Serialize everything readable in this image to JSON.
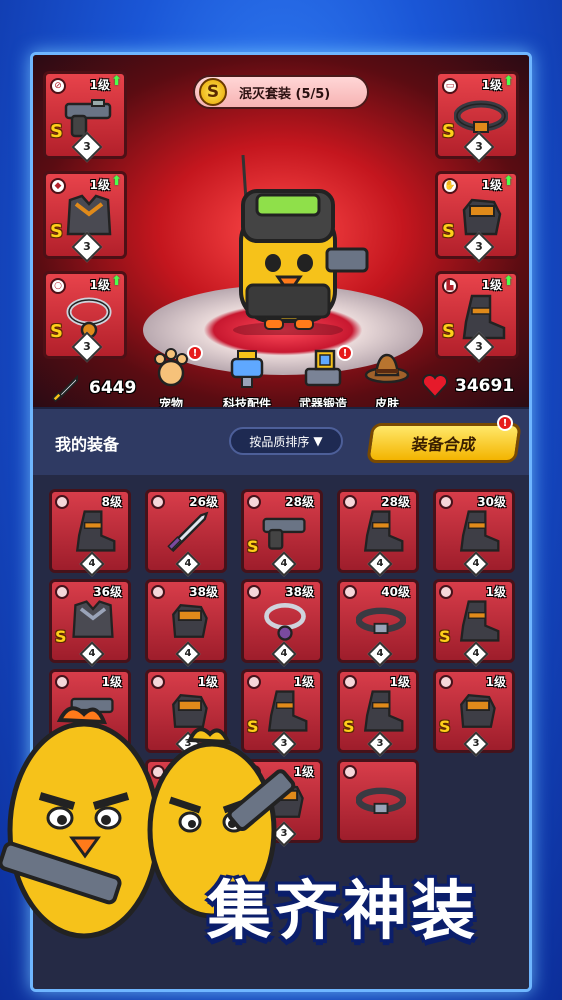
{
  "set_banner": {
    "grade": "S",
    "name": "泯灭套装 (5/5)"
  },
  "equipped": [
    {
      "slot": "weapon",
      "level": "1级",
      "grade": "S",
      "stars": "3",
      "icon": "pistol-icon"
    },
    {
      "slot": "armor",
      "level": "1级",
      "grade": "S",
      "stars": "3",
      "icon": "armor-icon"
    },
    {
      "slot": "necklace",
      "level": "1级",
      "grade": "S",
      "stars": "3",
      "icon": "necklace-icon"
    },
    {
      "slot": "belt",
      "level": "1级",
      "grade": "S",
      "stars": "3",
      "icon": "belt-icon"
    },
    {
      "slot": "gloves",
      "level": "1级",
      "grade": "S",
      "stars": "3",
      "icon": "glove-icon"
    },
    {
      "slot": "boots",
      "level": "1级",
      "grade": "S",
      "stars": "3",
      "icon": "boot-icon"
    }
  ],
  "features": [
    {
      "label": "宠物",
      "icon": "paw-icon",
      "badge": "!"
    },
    {
      "label": "科技配件",
      "icon": "tech-icon",
      "badge": ""
    },
    {
      "label": "武器锻造",
      "icon": "forge-icon",
      "badge": "!"
    },
    {
      "label": "皮肤",
      "icon": "hat-icon",
      "badge": ""
    }
  ],
  "stats": {
    "attack": "6449",
    "health": "34691"
  },
  "equip_bar": {
    "title": "我的装备",
    "sort_label": "按品质排序",
    "merge_label": "装备合成",
    "merge_badge": "!"
  },
  "inventory": [
    {
      "level": "8级",
      "grade": "",
      "stars": "4",
      "icon": "boot-icon"
    },
    {
      "level": "26级",
      "grade": "",
      "stars": "4",
      "icon": "sword-icon"
    },
    {
      "level": "28级",
      "grade": "S",
      "stars": "4",
      "icon": "pistol-icon"
    },
    {
      "level": "28级",
      "grade": "",
      "stars": "4",
      "icon": "boot-icon"
    },
    {
      "level": "30级",
      "grade": "",
      "stars": "4",
      "icon": "boot-icon"
    },
    {
      "level": "36级",
      "grade": "S",
      "stars": "4",
      "icon": "armor-icon"
    },
    {
      "level": "38级",
      "grade": "",
      "stars": "4",
      "icon": "glove-icon"
    },
    {
      "level": "38级",
      "grade": "",
      "stars": "4",
      "icon": "necklace-icon"
    },
    {
      "level": "40级",
      "grade": "",
      "stars": "4",
      "icon": "belt-icon"
    },
    {
      "level": "1级",
      "grade": "S",
      "stars": "4",
      "icon": "boot-icon"
    },
    {
      "level": "1级",
      "grade": "",
      "stars": "",
      "icon": "pistol-icon"
    },
    {
      "level": "1级",
      "grade": "",
      "stars": "3",
      "icon": "glove-icon"
    },
    {
      "level": "1级",
      "grade": "S",
      "stars": "3",
      "icon": "boot-icon"
    },
    {
      "level": "1级",
      "grade": "S",
      "stars": "3",
      "icon": "boot-icon"
    },
    {
      "level": "1级",
      "grade": "S",
      "stars": "3",
      "icon": "glove-icon"
    },
    {
      "level": "1级",
      "grade": "",
      "stars": "",
      "icon": "boot-icon"
    },
    {
      "level": "1级",
      "grade": "",
      "stars": "",
      "icon": "belt-icon"
    },
    {
      "level": "1级",
      "grade": "S",
      "stars": "3",
      "icon": "glove-icon"
    },
    {
      "level": "",
      "grade": "",
      "stars": "",
      "icon": "belt-icon"
    }
  ],
  "promo": {
    "text": "集齐神装"
  },
  "colors": {
    "slot_red": "#d83d4a",
    "gold": "#ffd01a",
    "frame_blue": "#1a56d6",
    "merge_yellow": "#f3b400"
  }
}
